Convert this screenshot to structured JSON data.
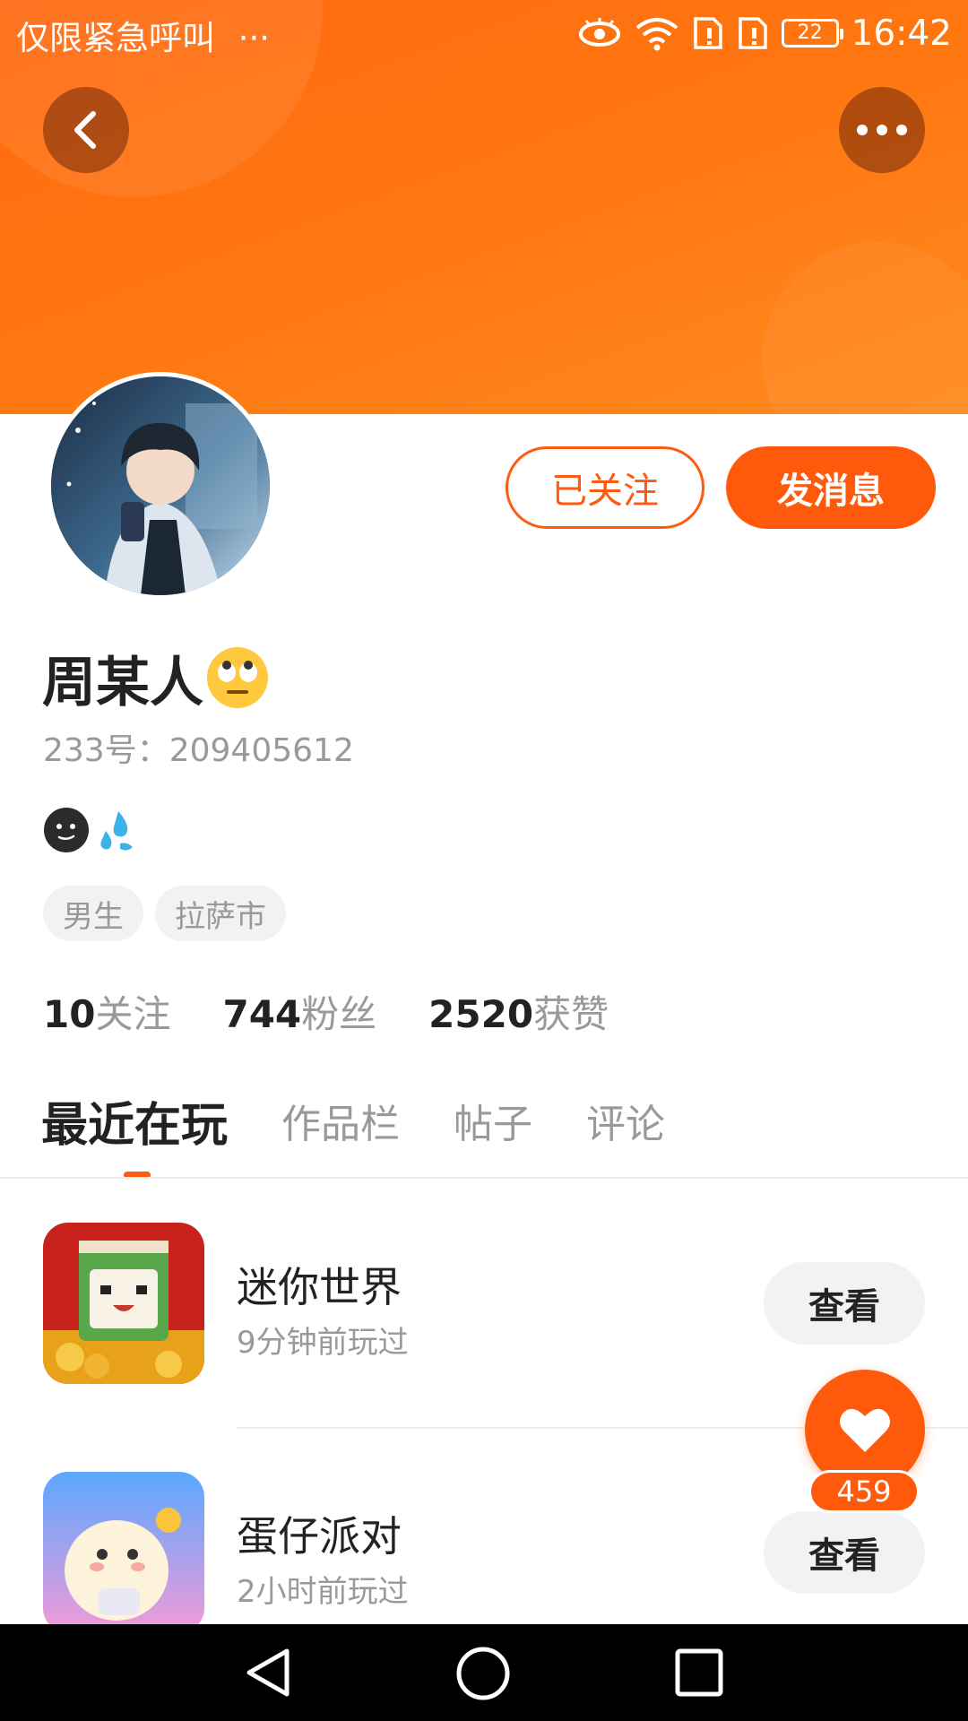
{
  "status_bar": {
    "carrier": "仅限紧急呼叫",
    "more_dots": "···",
    "time": "16:42",
    "battery": "22"
  },
  "header": {
    "accent": "#ff6a12"
  },
  "actions": {
    "followed_label": "已关注",
    "message_label": "发消息"
  },
  "profile": {
    "name": "周某人",
    "name_emoji": "eye-roll-emoji",
    "id_line": "233号：209405612",
    "bio_icons": [
      "dark-face-emoji",
      "sweat-drops-emoji"
    ],
    "tags": [
      "男生",
      "拉萨市"
    ]
  },
  "stats": [
    {
      "num": "10",
      "label": "关注"
    },
    {
      "num": "744",
      "label": "粉丝"
    },
    {
      "num": "2520",
      "label": "获赞"
    }
  ],
  "tabs": [
    "最近在玩",
    "作品栏",
    "帖子",
    "评论"
  ],
  "games": [
    {
      "name": "迷你世界",
      "time": "9分钟前玩过",
      "button": "查看"
    },
    {
      "name": "蛋仔派对",
      "time": "2小时前玩过",
      "button": "查看"
    }
  ],
  "like": {
    "count": "459"
  },
  "colors": {
    "brand": "#ff5a0c",
    "text": "#222222",
    "muted": "#999999"
  }
}
